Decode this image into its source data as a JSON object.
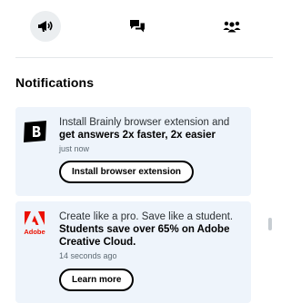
{
  "tabs": [
    {
      "icon": "notifications-icon",
      "active": true
    },
    {
      "icon": "chat-icon",
      "active": false
    },
    {
      "icon": "friends-icon",
      "active": false
    }
  ],
  "heading": "Notifications",
  "notifications": [
    {
      "logo": "brainly-logo",
      "text_plain": "Install Brainly browser extension and",
      "text_bold": "get answers 2x faster, 2x easier",
      "time": "just now",
      "button": "Install browser extension"
    },
    {
      "logo": "adobe-logo",
      "logo_text": "Adobe",
      "text_plain": "Create like a pro. Save like a student.",
      "text_bold": "Students save over 65% on Adobe Creative Cloud.",
      "time": "14 seconds ago",
      "button": "Learn more"
    }
  ],
  "colors": {
    "card_bg": "#eef4fb",
    "adobe_red": "#eb1000",
    "active_tab_bg": "#ebeef0"
  }
}
